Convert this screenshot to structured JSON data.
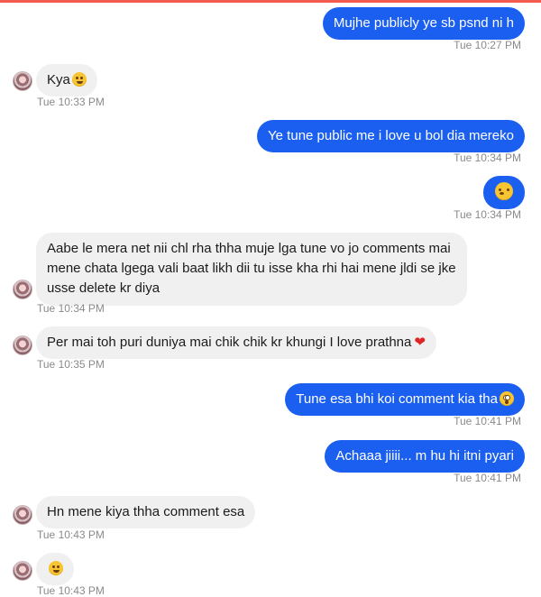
{
  "messages": [
    {
      "dir": "out",
      "text": "Mujhe publicly ye sb psnd ni h",
      "time": "Tue 10:27 PM"
    },
    {
      "dir": "in",
      "text": "Kya",
      "emoji": "grin-sweat-icon",
      "time": "Tue 10:33 PM"
    },
    {
      "dir": "out",
      "text": "Ye tune public me i love u bol dia mereko",
      "time": "Tue 10:34 PM"
    },
    {
      "dir": "out",
      "text": "",
      "emoji": "hushed-face-icon",
      "time": "Tue 10:34 PM"
    },
    {
      "dir": "in",
      "text": "Aabe le mera net nii chl rha thha muje lga tune vo jo comments mai mene chata lgega vali baat likh dii tu isse kha rhi hai mene jldi se jke usse delete kr diya",
      "time": "Tue 10:34 PM"
    },
    {
      "dir": "in",
      "text": "Per mai toh puri duniya mai chik chik kr khungi I love prathna",
      "emoji": "heart-icon",
      "time": "Tue 10:35 PM"
    },
    {
      "dir": "out",
      "text": "Tune esa bhi koi comment kia tha",
      "emoji": "flushed-face-icon",
      "time": "Tue 10:41 PM"
    },
    {
      "dir": "out",
      "text": "Achaaa jiiii... m hu hi itni pyari",
      "time": "Tue 10:41 PM"
    },
    {
      "dir": "in",
      "text": "Hn mene kiya thha comment esa",
      "time": "Tue 10:43 PM"
    },
    {
      "dir": "in",
      "text": "",
      "emoji": "relieved-face-icon",
      "time": "Tue 10:43 PM"
    }
  ],
  "colors": {
    "outgoing_bubble": "#1a5ff0",
    "incoming_bubble": "#f0f0f0",
    "timestamp": "#8a8a8a"
  }
}
